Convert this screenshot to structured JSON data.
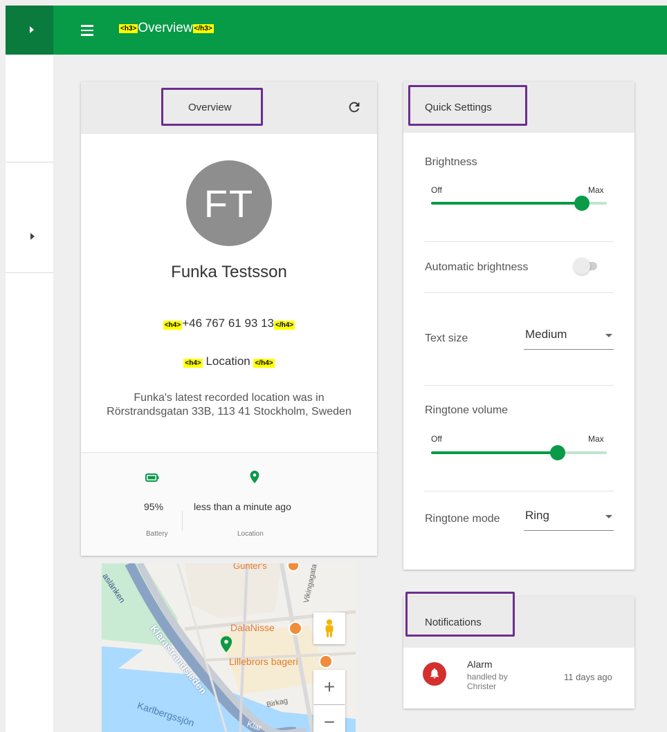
{
  "header": {
    "title_open_tag": "<h3>",
    "title": "Overview",
    "title_close_tag": "</h3>"
  },
  "overview": {
    "card_title": "Overview",
    "avatar_initials": "FT",
    "name": "Funka Testsson",
    "phone_open_tag": "<h4>",
    "phone": "+46 767 61 93 13",
    "phone_close_tag": "</h4>",
    "location_open_tag": "<h4>",
    "location_title": " Location ",
    "location_close_tag": "</h4>",
    "location_description": "Funka's latest recorded location was in Rörstrandsgatan 33B, 113 41 Stockholm, Sweden",
    "battery_value": "95%",
    "battery_caption": "Battery",
    "location_value": "less than a minute ago",
    "location_caption": "Location"
  },
  "map": {
    "labels": {
      "gunters": "Gunter's",
      "dalanisse": "DalaNisse",
      "lillebrors": "Lillebrors bageri",
      "vikingagata": "Vikingagata",
      "klarastrandsleden": "Klarastrandsleden",
      "karlbergssjon": "Karlbergssjön",
      "birkag": "Birkag",
      "klarabanken": "aslänken",
      "klar": "Klar"
    },
    "zoom_in": "+",
    "zoom_out": "−"
  },
  "quick_settings": {
    "title": "Quick Settings",
    "brightness": {
      "label": "Brightness",
      "min_label": "Off",
      "max_label": "Max",
      "level": 0.86
    },
    "auto_brightness": {
      "label": "Automatic brightness",
      "enabled": false
    },
    "text_size": {
      "label": "Text size",
      "value": "Medium"
    },
    "ringtone_volume": {
      "label": "Ringtone volume",
      "min_label": "Off",
      "max_label": "Max",
      "level": 0.72
    },
    "ringtone_mode": {
      "label": "Ringtone mode",
      "value": "Ring"
    }
  },
  "notifications": {
    "title": "Notifications",
    "items": [
      {
        "title": "Alarm",
        "subtitle": "handled by Christer",
        "time": "11 days ago"
      }
    ]
  },
  "colors": {
    "header_green": "#079a47",
    "sidebar_green": "#0a7b3c",
    "accent": "#0a9a48",
    "highlight_border": "#6b2e8f",
    "tag_yellow": "#ffff00",
    "alarm_red": "#d32f2f"
  }
}
